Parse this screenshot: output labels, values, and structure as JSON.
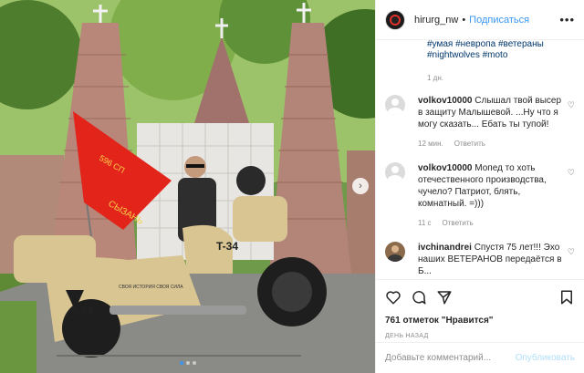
{
  "post": {
    "username": "hirurg_nw",
    "separator": "•",
    "follow_label": "Подписаться",
    "more_label": "•••",
    "caption_tags": [
      "#умая",
      "#невропа",
      "#ветераны",
      "#nightwolves",
      "#moto"
    ],
    "caption_time": "1 дн.",
    "photo": {
      "flag_text_line1": "596 СП",
      "flag_text_line2": "СЫЗАНЬ",
      "bike_tank_label": "T-34",
      "bike_badge_label": "T-34",
      "bike_side_text": "СВОЯ ИСТОРИЯ СВОЯ СИЛА"
    },
    "image_count_dots": 3,
    "active_dot": 1
  },
  "comments": [
    {
      "username": "volkov10000",
      "text": "Слышал твой высер в защиту Малышевой. ...Ну что я могу сказать... Ебать ты тупой!",
      "time": "12 мин.",
      "reply_label": "Ответить"
    },
    {
      "username": "volkov10000",
      "text": "Мопед то хоть отечественного производства, чучело? Патриот, блять, комнатный. =)))",
      "time": "11 с",
      "reply_label": "Ответить"
    },
    {
      "username": "ivchinandrei",
      "text": "Спустя 75 лет!!! Эхо наших ВЕТЕРАНОВ передаётся в Б..."
    }
  ],
  "actions": {
    "likes_text": "761 отметок \"Нравится\"",
    "timestamp": "ДЕНЬ НАЗАД"
  },
  "comment_box": {
    "placeholder": "Добавьте комментарий...",
    "publish_label": "Опубликовать"
  },
  "colors": {
    "link_blue": "#3897f0",
    "hashtag": "#00376b",
    "muted": "#8e8e8e",
    "flag_red": "#e3241b",
    "bike_sand": "#d8c592"
  }
}
